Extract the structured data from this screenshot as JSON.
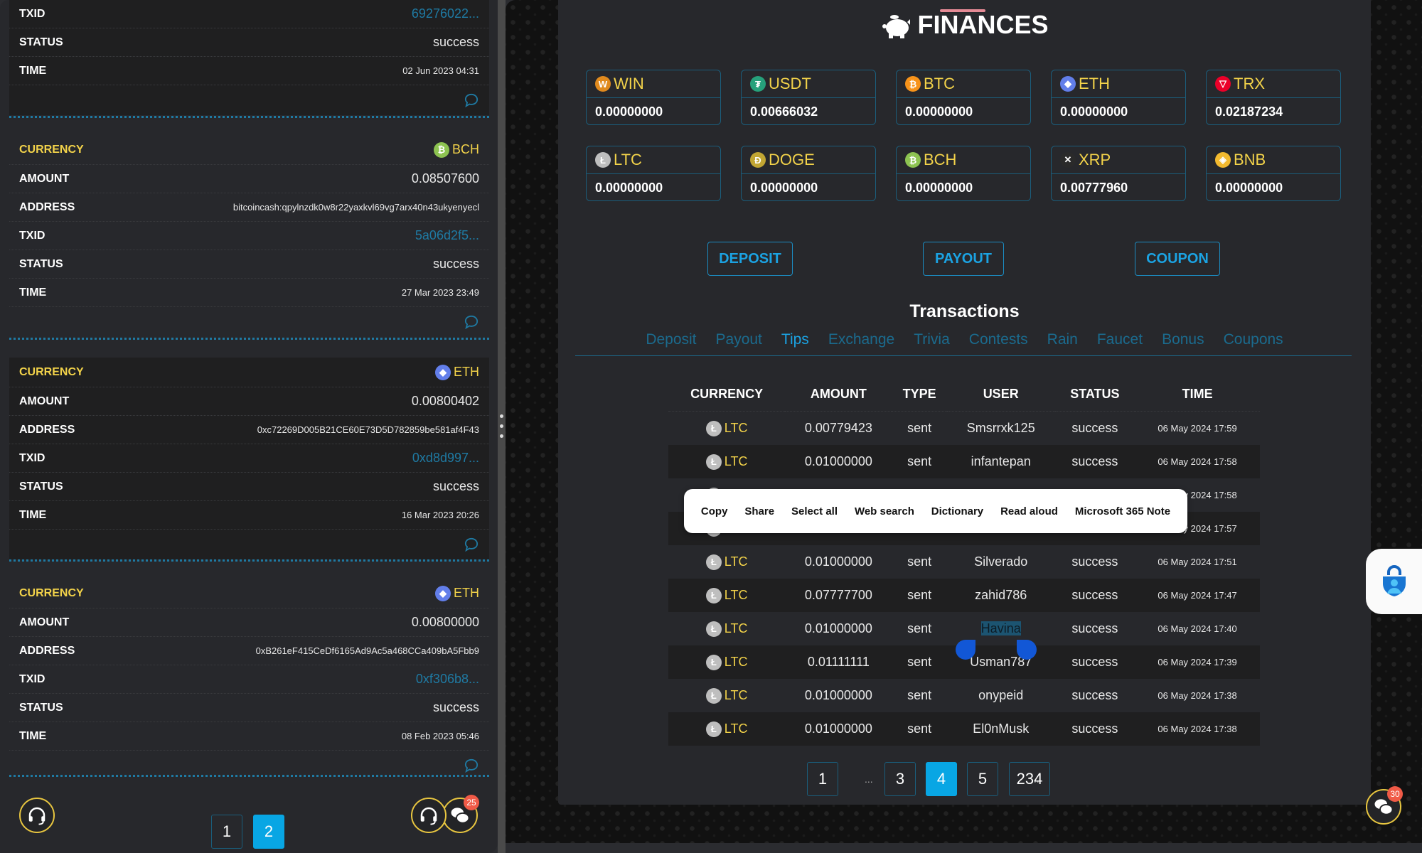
{
  "left_panel": {
    "labels": {
      "currency": "CURRENCY",
      "amount": "AMOUNT",
      "address": "ADDRESS",
      "txid": "TXID",
      "status": "STATUS",
      "time": "TIME"
    },
    "partial_card": {
      "txid": "69276022...",
      "status": "success",
      "time": "02 Jun 2023 04:31"
    },
    "cards": [
      {
        "currency": "BCH",
        "coin_icon": "bch-icon",
        "amount": "0.08507600",
        "address": "bitcoincash:qpylnzdk0w8r22yaxkvl69vg7arx40n43ukyenyecl",
        "txid": "5a06d2f5...",
        "status": "success",
        "time": "27 Mar 2023 23:49"
      },
      {
        "currency": "ETH",
        "coin_icon": "eth-icon",
        "amount": "0.00800402",
        "address": "0xc72269D005B21CE60E73D5D782859be581af4F43",
        "txid": "0xd8d997...",
        "status": "success",
        "time": "16 Mar 2023 20:26"
      },
      {
        "currency": "ETH",
        "coin_icon": "eth-icon",
        "amount": "0.00800000",
        "address": "0xB261eF415CeDf6165Ad9Ac5a468CCa409bA5Fbb9",
        "txid": "0xf306b8...",
        "status": "success",
        "time": "08 Feb 2023 05:46"
      }
    ],
    "pagination": {
      "pages": [
        "1",
        "2"
      ],
      "active": "2"
    },
    "chat_badge": "25"
  },
  "finances": {
    "title": "FINANCES",
    "balances": [
      {
        "coin": "WIN",
        "balance": "0.00000000",
        "color": "#e08a1e",
        "glyph": "W"
      },
      {
        "coin": "USDT",
        "balance": "0.00666032",
        "color": "#26a17b",
        "glyph": "₮"
      },
      {
        "coin": "BTC",
        "balance": "0.00000000",
        "color": "#f7931a",
        "glyph": "₿"
      },
      {
        "coin": "ETH",
        "balance": "0.00000000",
        "color": "#627eea",
        "glyph": "◆"
      },
      {
        "coin": "TRX",
        "balance": "0.02187234",
        "color": "#eb0029",
        "glyph": "▽"
      },
      {
        "coin": "LTC",
        "balance": "0.00000000",
        "color": "#bebebe",
        "glyph": "Ł"
      },
      {
        "coin": "DOGE",
        "balance": "0.00000000",
        "color": "#c2a633",
        "glyph": "Ð"
      },
      {
        "coin": "BCH",
        "balance": "0.00000000",
        "color": "#8dc351",
        "glyph": "₿"
      },
      {
        "coin": "XRP",
        "balance": "0.00777960",
        "color": "#2a2a2a",
        "glyph": "✕"
      },
      {
        "coin": "BNB",
        "balance": "0.00000000",
        "color": "#f3ba2f",
        "glyph": "◈"
      }
    ],
    "buttons": {
      "deposit": "DEPOSIT",
      "payout": "PAYOUT",
      "coupon": "COUPON"
    }
  },
  "transactions": {
    "title": "Transactions",
    "tabs": [
      "Deposit",
      "Payout",
      "Tips",
      "Exchange",
      "Trivia",
      "Contests",
      "Rain",
      "Faucet",
      "Bonus",
      "Coupons"
    ],
    "active_tab": "Tips",
    "columns": [
      "CURRENCY",
      "AMOUNT",
      "TYPE",
      "USER",
      "STATUS",
      "TIME"
    ],
    "rows": [
      {
        "currency": "LTC",
        "amount": "0.00779423",
        "type": "sent",
        "user": "Smsrrxk125",
        "status": "success",
        "time": "06 May 2024 17:59"
      },
      {
        "currency": "LTC",
        "amount": "0.01000000",
        "type": "sent",
        "user": "infantepan",
        "status": "success",
        "time": "06 May 2024 17:58"
      },
      {
        "currency": "LTC",
        "amount": "",
        "type": "",
        "user": "",
        "status": "",
        "time": "06 May 2024 17:58"
      },
      {
        "currency": "LTC",
        "amount": "",
        "type": "",
        "user": "",
        "status": "",
        "time": "06 May 2024 17:57"
      },
      {
        "currency": "LTC",
        "amount": "0.01000000",
        "type": "sent",
        "user": "Silverado",
        "status": "success",
        "time": "06 May 2024 17:51"
      },
      {
        "currency": "LTC",
        "amount": "0.07777700",
        "type": "sent",
        "user": "zahid786",
        "status": "success",
        "time": "06 May 2024 17:47"
      },
      {
        "currency": "LTC",
        "amount": "0.01000000",
        "type": "sent",
        "user": "Havina",
        "status": "success",
        "time": "06 May 2024 17:40"
      },
      {
        "currency": "LTC",
        "amount": "0.01111111",
        "type": "sent",
        "user": "Usman787",
        "status": "success",
        "time": "06 May 2024 17:39"
      },
      {
        "currency": "LTC",
        "amount": "0.01000000",
        "type": "sent",
        "user": "onypeid",
        "status": "success",
        "time": "06 May 2024 17:38"
      },
      {
        "currency": "LTC",
        "amount": "0.01000000",
        "type": "sent",
        "user": "El0nMusk",
        "status": "success",
        "time": "06 May 2024 17:38"
      }
    ],
    "selected_text": "Havina",
    "pagination": {
      "items": [
        "1",
        "...",
        "3",
        "4",
        "5",
        "...",
        "234"
      ],
      "active": "4"
    }
  },
  "context_menu": [
    "Copy",
    "Share",
    "Select all",
    "Web search",
    "Dictionary",
    "Read aloud",
    "Microsoft 365 Note"
  ],
  "chat_badge_right": "30"
}
